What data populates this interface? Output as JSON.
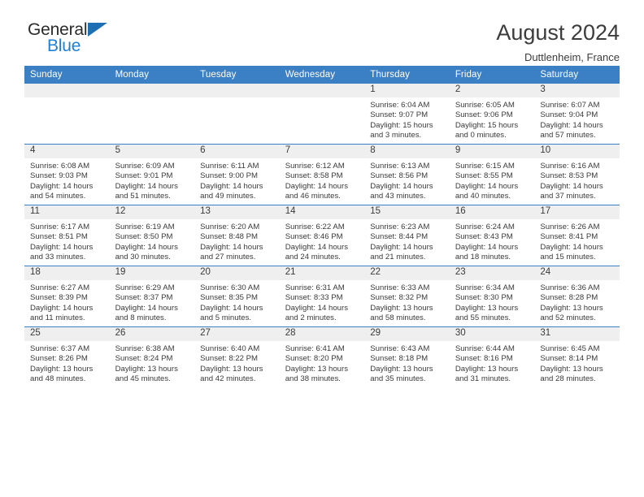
{
  "logo": {
    "word_one": "General",
    "word_two": "Blue",
    "triangle_color": "#1f6fb5",
    "blue_text_color": "#1f7fd4"
  },
  "header": {
    "title": "August 2024",
    "subtitle": "Duttlenheim, France",
    "accent_color": "#3b7fc4"
  },
  "weekday_headers": [
    "Sunday",
    "Monday",
    "Tuesday",
    "Wednesday",
    "Thursday",
    "Friday",
    "Saturday"
  ],
  "labels": {
    "sunrise_prefix": "Sunrise: ",
    "sunset_prefix": "Sunset: ",
    "daylight_prefix": "Daylight: "
  },
  "weeks": [
    [
      {
        "day": "",
        "empty": true
      },
      {
        "day": "",
        "empty": true
      },
      {
        "day": "",
        "empty": true
      },
      {
        "day": "",
        "empty": true
      },
      {
        "day": "1",
        "sunrise": "Sunrise: 6:04 AM",
        "sunset": "Sunset: 9:07 PM",
        "daylight": "Daylight: 15 hours and 3 minutes."
      },
      {
        "day": "2",
        "sunrise": "Sunrise: 6:05 AM",
        "sunset": "Sunset: 9:06 PM",
        "daylight": "Daylight: 15 hours and 0 minutes."
      },
      {
        "day": "3",
        "sunrise": "Sunrise: 6:07 AM",
        "sunset": "Sunset: 9:04 PM",
        "daylight": "Daylight: 14 hours and 57 minutes."
      }
    ],
    [
      {
        "day": "4",
        "sunrise": "Sunrise: 6:08 AM",
        "sunset": "Sunset: 9:03 PM",
        "daylight": "Daylight: 14 hours and 54 minutes."
      },
      {
        "day": "5",
        "sunrise": "Sunrise: 6:09 AM",
        "sunset": "Sunset: 9:01 PM",
        "daylight": "Daylight: 14 hours and 51 minutes."
      },
      {
        "day": "6",
        "sunrise": "Sunrise: 6:11 AM",
        "sunset": "Sunset: 9:00 PM",
        "daylight": "Daylight: 14 hours and 49 minutes."
      },
      {
        "day": "7",
        "sunrise": "Sunrise: 6:12 AM",
        "sunset": "Sunset: 8:58 PM",
        "daylight": "Daylight: 14 hours and 46 minutes."
      },
      {
        "day": "8",
        "sunrise": "Sunrise: 6:13 AM",
        "sunset": "Sunset: 8:56 PM",
        "daylight": "Daylight: 14 hours and 43 minutes."
      },
      {
        "day": "9",
        "sunrise": "Sunrise: 6:15 AM",
        "sunset": "Sunset: 8:55 PM",
        "daylight": "Daylight: 14 hours and 40 minutes."
      },
      {
        "day": "10",
        "sunrise": "Sunrise: 6:16 AM",
        "sunset": "Sunset: 8:53 PM",
        "daylight": "Daylight: 14 hours and 37 minutes."
      }
    ],
    [
      {
        "day": "11",
        "sunrise": "Sunrise: 6:17 AM",
        "sunset": "Sunset: 8:51 PM",
        "daylight": "Daylight: 14 hours and 33 minutes."
      },
      {
        "day": "12",
        "sunrise": "Sunrise: 6:19 AM",
        "sunset": "Sunset: 8:50 PM",
        "daylight": "Daylight: 14 hours and 30 minutes."
      },
      {
        "day": "13",
        "sunrise": "Sunrise: 6:20 AM",
        "sunset": "Sunset: 8:48 PM",
        "daylight": "Daylight: 14 hours and 27 minutes."
      },
      {
        "day": "14",
        "sunrise": "Sunrise: 6:22 AM",
        "sunset": "Sunset: 8:46 PM",
        "daylight": "Daylight: 14 hours and 24 minutes."
      },
      {
        "day": "15",
        "sunrise": "Sunrise: 6:23 AM",
        "sunset": "Sunset: 8:44 PM",
        "daylight": "Daylight: 14 hours and 21 minutes."
      },
      {
        "day": "16",
        "sunrise": "Sunrise: 6:24 AM",
        "sunset": "Sunset: 8:43 PM",
        "daylight": "Daylight: 14 hours and 18 minutes."
      },
      {
        "day": "17",
        "sunrise": "Sunrise: 6:26 AM",
        "sunset": "Sunset: 8:41 PM",
        "daylight": "Daylight: 14 hours and 15 minutes."
      }
    ],
    [
      {
        "day": "18",
        "sunrise": "Sunrise: 6:27 AM",
        "sunset": "Sunset: 8:39 PM",
        "daylight": "Daylight: 14 hours and 11 minutes."
      },
      {
        "day": "19",
        "sunrise": "Sunrise: 6:29 AM",
        "sunset": "Sunset: 8:37 PM",
        "daylight": "Daylight: 14 hours and 8 minutes."
      },
      {
        "day": "20",
        "sunrise": "Sunrise: 6:30 AM",
        "sunset": "Sunset: 8:35 PM",
        "daylight": "Daylight: 14 hours and 5 minutes."
      },
      {
        "day": "21",
        "sunrise": "Sunrise: 6:31 AM",
        "sunset": "Sunset: 8:33 PM",
        "daylight": "Daylight: 14 hours and 2 minutes."
      },
      {
        "day": "22",
        "sunrise": "Sunrise: 6:33 AM",
        "sunset": "Sunset: 8:32 PM",
        "daylight": "Daylight: 13 hours and 58 minutes."
      },
      {
        "day": "23",
        "sunrise": "Sunrise: 6:34 AM",
        "sunset": "Sunset: 8:30 PM",
        "daylight": "Daylight: 13 hours and 55 minutes."
      },
      {
        "day": "24",
        "sunrise": "Sunrise: 6:36 AM",
        "sunset": "Sunset: 8:28 PM",
        "daylight": "Daylight: 13 hours and 52 minutes."
      }
    ],
    [
      {
        "day": "25",
        "sunrise": "Sunrise: 6:37 AM",
        "sunset": "Sunset: 8:26 PM",
        "daylight": "Daylight: 13 hours and 48 minutes."
      },
      {
        "day": "26",
        "sunrise": "Sunrise: 6:38 AM",
        "sunset": "Sunset: 8:24 PM",
        "daylight": "Daylight: 13 hours and 45 minutes."
      },
      {
        "day": "27",
        "sunrise": "Sunrise: 6:40 AM",
        "sunset": "Sunset: 8:22 PM",
        "daylight": "Daylight: 13 hours and 42 minutes."
      },
      {
        "day": "28",
        "sunrise": "Sunrise: 6:41 AM",
        "sunset": "Sunset: 8:20 PM",
        "daylight": "Daylight: 13 hours and 38 minutes."
      },
      {
        "day": "29",
        "sunrise": "Sunrise: 6:43 AM",
        "sunset": "Sunset: 8:18 PM",
        "daylight": "Daylight: 13 hours and 35 minutes."
      },
      {
        "day": "30",
        "sunrise": "Sunrise: 6:44 AM",
        "sunset": "Sunset: 8:16 PM",
        "daylight": "Daylight: 13 hours and 31 minutes."
      },
      {
        "day": "31",
        "sunrise": "Sunrise: 6:45 AM",
        "sunset": "Sunset: 8:14 PM",
        "daylight": "Daylight: 13 hours and 28 minutes."
      }
    ]
  ]
}
